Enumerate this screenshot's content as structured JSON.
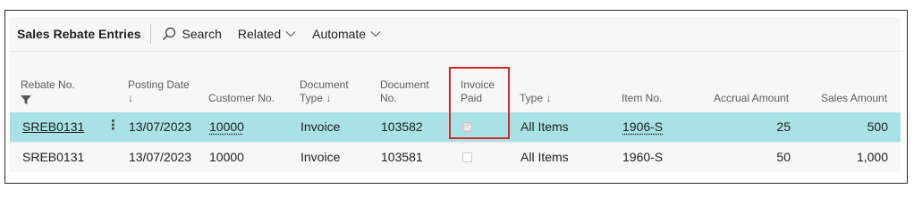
{
  "page": {
    "title": "Sales Rebate Entries",
    "actions": {
      "search": "Search",
      "related": "Related",
      "automate": "Automate"
    }
  },
  "columns": {
    "rebate_no": "Rebate No.",
    "posting_date_1": "Posting Date",
    "posting_date_sort": "↓",
    "customer_no": "Customer No.",
    "document_type_1": "Document",
    "document_type_2": "Type ↓",
    "document_no_1": "Document",
    "document_no_2": "No.",
    "invoice_paid_1": "Invoice",
    "invoice_paid_2": "Paid",
    "type": "Type ↓",
    "item_no": "Item No.",
    "accrual_amount": "Accrual Amount",
    "sales_amount": "Sales Amount"
  },
  "rows": [
    {
      "rebate_no": "SREB0131",
      "posting_date": "13/07/2023",
      "customer_no": "10000",
      "document_type": "Invoice",
      "document_no": "103582",
      "invoice_paid": true,
      "type": "All Items",
      "item_no": "1906-S",
      "accrual_amount": "25",
      "sales_amount": "500",
      "selected": true
    },
    {
      "rebate_no": "SREB0131",
      "posting_date": "13/07/2023",
      "customer_no": "10000",
      "document_type": "Invoice",
      "document_no": "103581",
      "invoice_paid": false,
      "type": "All Items",
      "item_no": "1960-S",
      "accrual_amount": "50",
      "sales_amount": "1,000",
      "selected": false
    }
  ],
  "colors": {
    "selected_row": "#a8e2e6",
    "highlight_border": "#d62828",
    "panel_bg": "#f7f7f7"
  },
  "icons": {
    "search": "search-icon",
    "chevron": "chevron-down-icon",
    "filter": "filter-icon",
    "row_menu": "more-vertical-icon"
  }
}
